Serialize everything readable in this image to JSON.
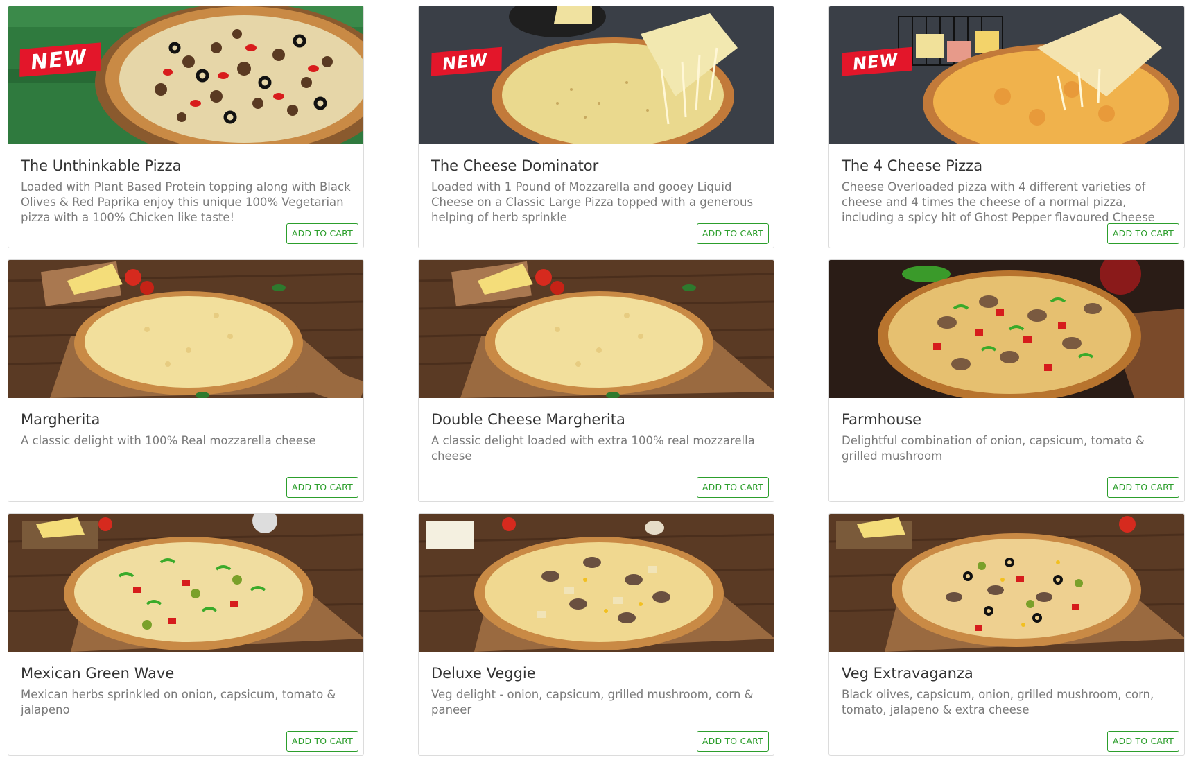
{
  "cards": [
    {
      "title": "The Unthinkable Pizza",
      "description": "Loaded with Plant Based Protein topping along with Black Olives & Red Paprika enjoy this unique 100% Vegetarian pizza with a 100% Chicken like taste!",
      "badge": "NEW",
      "button": "ADD TO CART"
    },
    {
      "title": "The Cheese Dominator",
      "description": "Loaded with 1 Pound of Mozzarella and gooey Liquid Cheese on a Classic Large Pizza topped with a generous helping of herb sprinkle",
      "badge": "NEW",
      "button": "ADD TO CART"
    },
    {
      "title": "The 4 Cheese Pizza",
      "description": "Cheese Overloaded pizza with 4 different varieties of cheese and 4 times the cheese of a normal pizza, including a spicy hit of Ghost Pepper flavoured Cheese",
      "badge": "NEW",
      "button": "ADD TO CART"
    },
    {
      "title": "Margherita",
      "description": "A classic delight with 100% Real mozzarella cheese",
      "button": "ADD TO CART"
    },
    {
      "title": "Double Cheese Margherita",
      "description": "A classic delight loaded with extra 100% real mozzarella cheese",
      "button": "ADD TO CART"
    },
    {
      "title": "Farmhouse",
      "description": "Delightful combination of onion, capsicum, tomato & grilled mushroom",
      "button": "ADD TO CART"
    },
    {
      "title": "Mexican Green Wave",
      "description": "Mexican herbs sprinkled on onion, capsicum, tomato & jalapeno",
      "button": "ADD TO CART"
    },
    {
      "title": "Deluxe Veggie",
      "description": "Veg delight - onion, capsicum, grilled mushroom, corn & paneer",
      "button": "ADD TO CART"
    },
    {
      "title": "Veg Extravaganza",
      "description": "Black olives, capsicum, onion, grilled mushroom, corn, tomato, jalapeno & extra cheese",
      "button": "ADD TO CART"
    }
  ],
  "colors": {
    "button_green": "#2c9e2c",
    "badge_red": "#e3162a",
    "title_text": "#333333",
    "desc_text": "#7a7a7a"
  }
}
